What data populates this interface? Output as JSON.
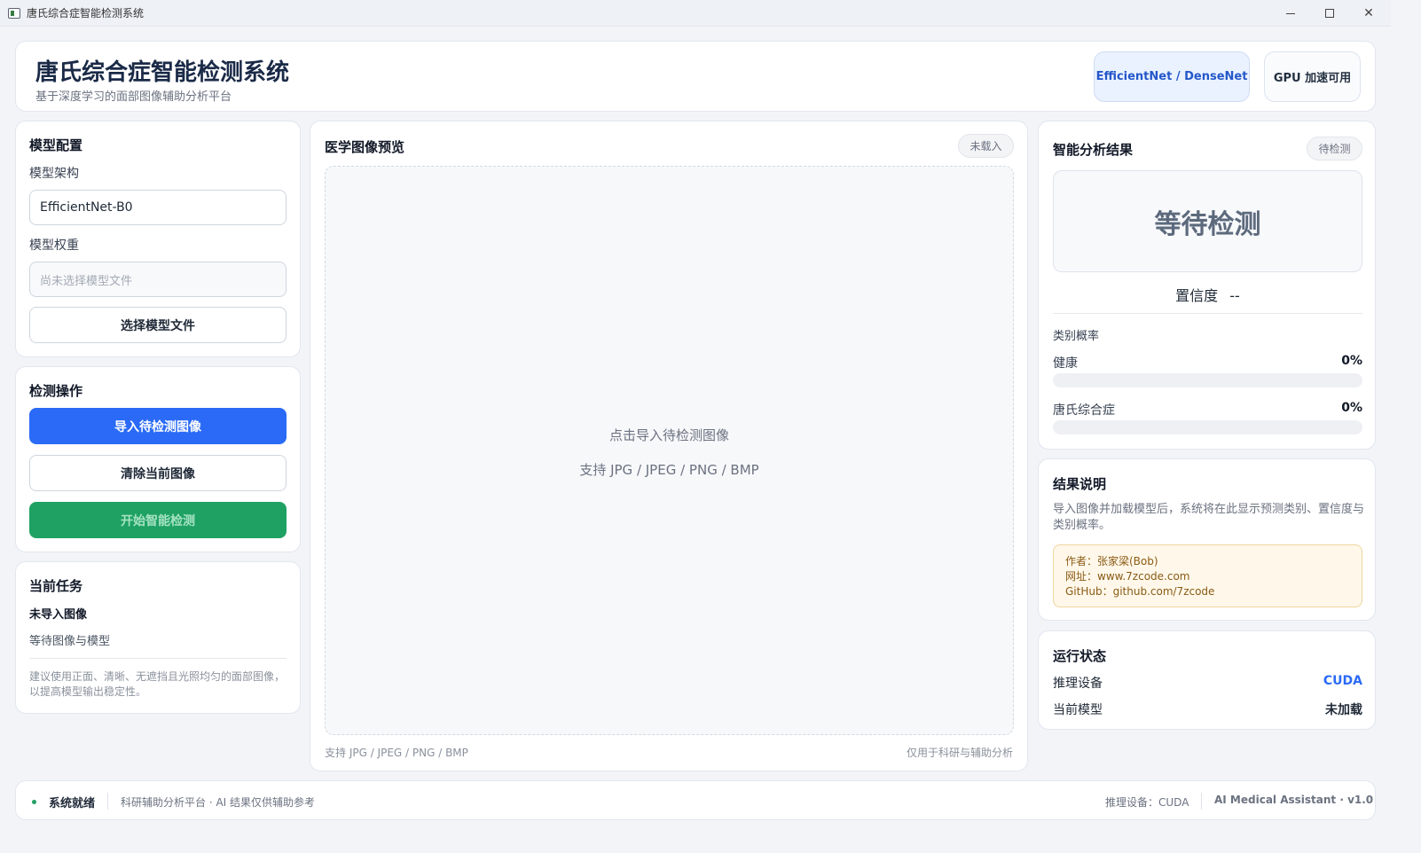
{
  "window": {
    "title": "唐氏综合症智能检测系统"
  },
  "header": {
    "title": "唐氏综合症智能检测系统",
    "subtitle": "基于深度学习的面部图像辅助分析平台",
    "arch_badge": "EfficientNet / DenseNet",
    "gpu_badge": "GPU 加速可用"
  },
  "model_config": {
    "title": "模型配置",
    "arch_label": "模型架构",
    "arch_value": "EfficientNet-B0",
    "weight_label": "模型权重",
    "weight_placeholder": "尚未选择模型文件",
    "choose_button": "选择模型文件"
  },
  "detect_ops": {
    "title": "检测操作",
    "import_button": "导入待检测图像",
    "clear_button": "清除当前图像",
    "start_button": "开始智能检测"
  },
  "current_task": {
    "title": "当前任务",
    "status": "未导入图像",
    "detail": "等待图像与模型",
    "tip": "建议使用正面、清晰、无遮挡且光照均匀的面部图像，以提高模型输出稳定性。"
  },
  "preview": {
    "title": "医学图像预览",
    "badge": "未载入",
    "drop_text": "点击导入待检测图像",
    "drop_formats": "支持 JPG / JPEG / PNG / BMP",
    "footer_left": "支持 JPG / JPEG / PNG / BMP",
    "footer_right": "仅用于科研与辅助分析"
  },
  "analysis": {
    "title": "智能分析结果",
    "badge": "待检测",
    "result": "等待检测",
    "confidence_label": "置信度",
    "confidence_value": "--",
    "prob_title": "类别概率",
    "classes": [
      {
        "name": "健康",
        "value": "0%",
        "fraction": 0
      },
      {
        "name": "唐氏综合症",
        "value": "0%",
        "fraction": 0
      }
    ]
  },
  "explain": {
    "title": "结果说明",
    "text": "导入图像并加载模型后，系统将在此显示预测类别、置信度与类别概率。",
    "author": "作者：张家梁(Bob)",
    "website": "网址：www.7zcode.com",
    "github": "GitHub：github.com/7zcode"
  },
  "runtime": {
    "title": "运行状态",
    "device_label": "推理设备",
    "device_value": "CUDA",
    "model_label": "当前模型",
    "model_value": "未加载"
  },
  "statusbar": {
    "ready": "系统就绪",
    "info": "科研辅助分析平台 · AI 结果仅供辅助参考",
    "device": "推理设备：CUDA",
    "version": "AI Medical Assistant · v1.0"
  },
  "colors": {
    "primary": "#2a6af6",
    "success": "#1ea163",
    "accent_bg": "#eaf2ff"
  }
}
